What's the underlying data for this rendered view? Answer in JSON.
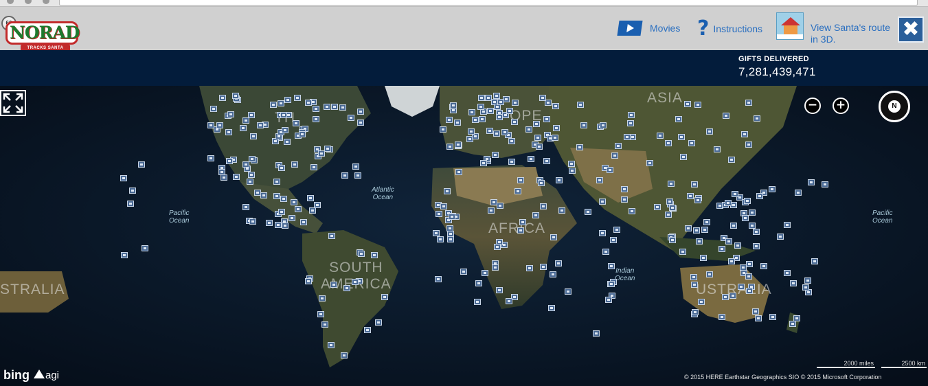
{
  "header": {
    "logo_text": "NORAD",
    "logo_sub": "TRACKS SANTA",
    "nav": {
      "movies": "Movies",
      "instructions": "Instructions",
      "route": "View Santa's route in 3D."
    },
    "close_label": "✖"
  },
  "gifts": {
    "label": "GIFTS DELIVERED",
    "count": "7,281,439,471"
  },
  "map": {
    "region_labels": {
      "asia": "ASIA",
      "europe": "OPE",
      "africa": "AFRICA",
      "south_america": "SOUTH\nAMERICA",
      "australia_left": "STRALIA",
      "australia_right": "USTRALIA",
      "north_america": "TH"
    },
    "ocean_labels": {
      "atlantic": "Atlantic\nOcean",
      "pacific_left": "Pacific\nOcean",
      "pacific_right": "Pacific\nOcean",
      "indian": "Indian\nOcean"
    },
    "zoom_out": "−",
    "zoom_in": "+",
    "compass": "N",
    "bing": "bing",
    "agi": "agi",
    "scale_miles": "2000 miles",
    "scale_km": "2500 km",
    "copyright": "© 2015 HERE    Earthstar Geographics SIO    © 2015 Microsoft Corporation"
  },
  "colors": {
    "header_bg": "#d0d0d0",
    "gift_band": "#031c3b",
    "link": "#2a6fc0",
    "marker": "#4a6a95"
  }
}
